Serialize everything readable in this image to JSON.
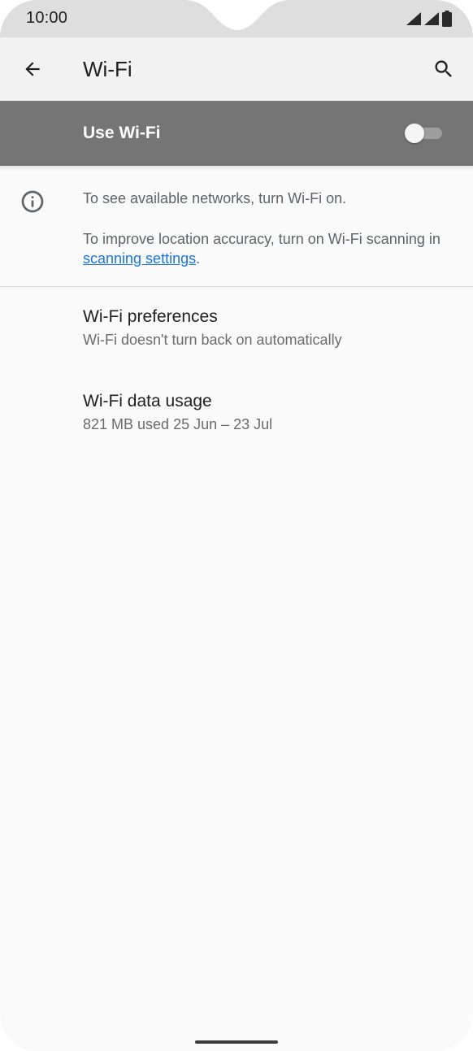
{
  "status_bar": {
    "time": "10:00",
    "icons": [
      "signal-icon",
      "signal-icon",
      "battery-icon"
    ]
  },
  "app_bar": {
    "title": "Wi-Fi",
    "back_icon": "arrow-back-icon",
    "search_icon": "search-icon"
  },
  "master_switch": {
    "label": "Use Wi-Fi",
    "state": "off"
  },
  "info": {
    "icon": "info-icon",
    "line1": "To see available networks, turn Wi-Fi on.",
    "line2_prefix": "To improve location accuracy, turn on Wi-Fi scanning in ",
    "link_text": "scanning settings",
    "line2_suffix": "."
  },
  "preferences": [
    {
      "title": "Wi-Fi preferences",
      "summary": "Wi-Fi doesn't turn back on automatically"
    },
    {
      "title": "Wi-Fi data usage",
      "summary": "821 MB used 25 Jun – 23 Jul"
    }
  ],
  "colors": {
    "status_bar_bg": "#dedede",
    "app_bar_bg": "#f2f2f2",
    "master_bar_bg": "#757575",
    "link": "#1a73e8",
    "background": "#fafafa"
  }
}
